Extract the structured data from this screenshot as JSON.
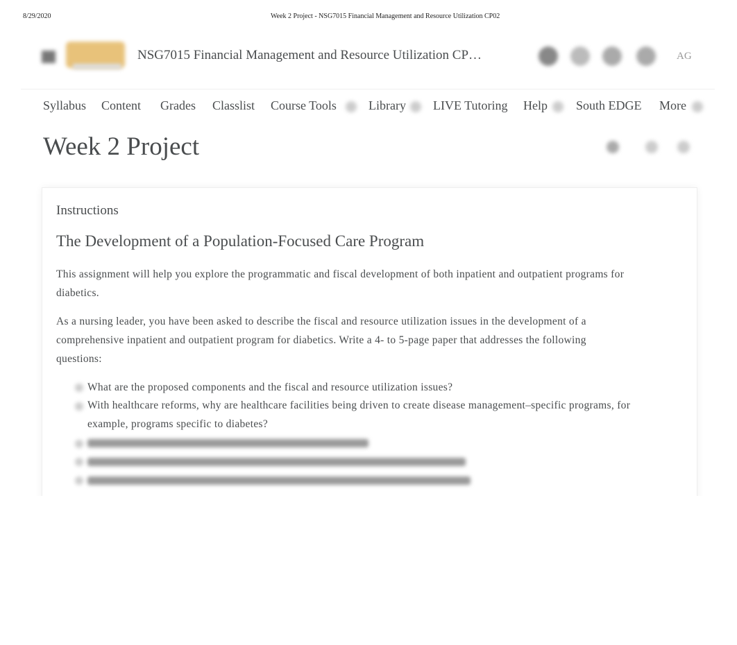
{
  "print_header": {
    "date": "8/29/2020",
    "title": "Week 2 Project - NSG7015 Financial Management and Resource Utilization CP02"
  },
  "header": {
    "course_title": "NSG7015 Financial Management and Resource Utilization CP…",
    "user_initials": "AG"
  },
  "nav": [
    "Syllabus",
    "Content",
    "Grades",
    "Classlist",
    "Course Tools",
    "Library",
    "LIVE Tutoring",
    "Help",
    "South EDGE",
    "More"
  ],
  "page_title": "Week 2 Project",
  "content": {
    "section_label": "Instructions",
    "heading": "The Development of a Population-Focused Care Program",
    "para1": "This assignment will help you explore the programmatic and fiscal development of both inpatient and outpatient programs for diabetics.",
    "para2": "As a nursing leader, you have been asked to describe the fiscal and resource utilization issues in the development of a comprehensive inpatient and outpatient program for diabetics. Write a 4- to 5-page paper that addresses the following questions:",
    "questions": [
      "What are the proposed components and the fiscal and resource utilization issues?",
      "With healthcare reforms, why are healthcare facilities being driven to create disease management–specific programs, for example, programs specific to diabetes?"
    ]
  }
}
